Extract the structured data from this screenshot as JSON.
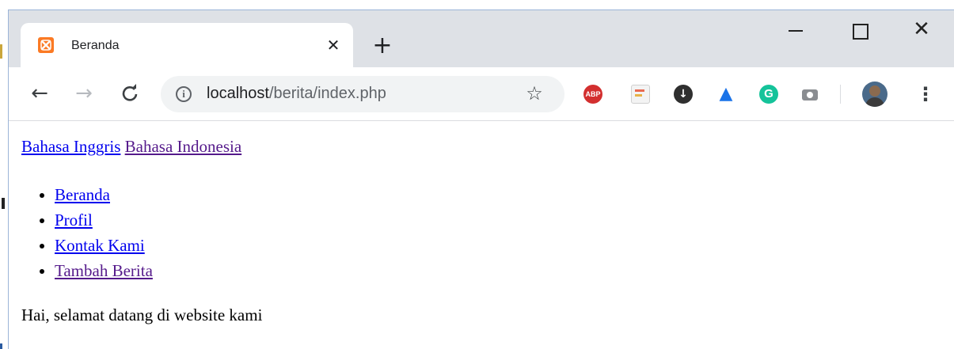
{
  "tab": {
    "title": "Beranda",
    "favicon": "xampp-icon"
  },
  "omnibox": {
    "url_host": "localhost",
    "url_path": "/berita/index.php"
  },
  "extensions": {
    "abp_label": "ABP",
    "grammarly_label": "G"
  },
  "page": {
    "language_links": [
      {
        "label": "Bahasa Inggris",
        "visited": false
      },
      {
        "label": "Bahasa Indonesia",
        "visited": true
      }
    ],
    "nav": [
      {
        "label": "Beranda",
        "visited": false
      },
      {
        "label": "Profil",
        "visited": false
      },
      {
        "label": "Kontak Kami",
        "visited": false
      },
      {
        "label": "Tambah Berita",
        "visited": true
      }
    ],
    "welcome": "Hai, selamat datang di website kami"
  },
  "colors": {
    "link": "#0000ee",
    "visited_link": "#551a8b",
    "titlebar": "#dee1e6",
    "favicon": "#fb7a24"
  }
}
